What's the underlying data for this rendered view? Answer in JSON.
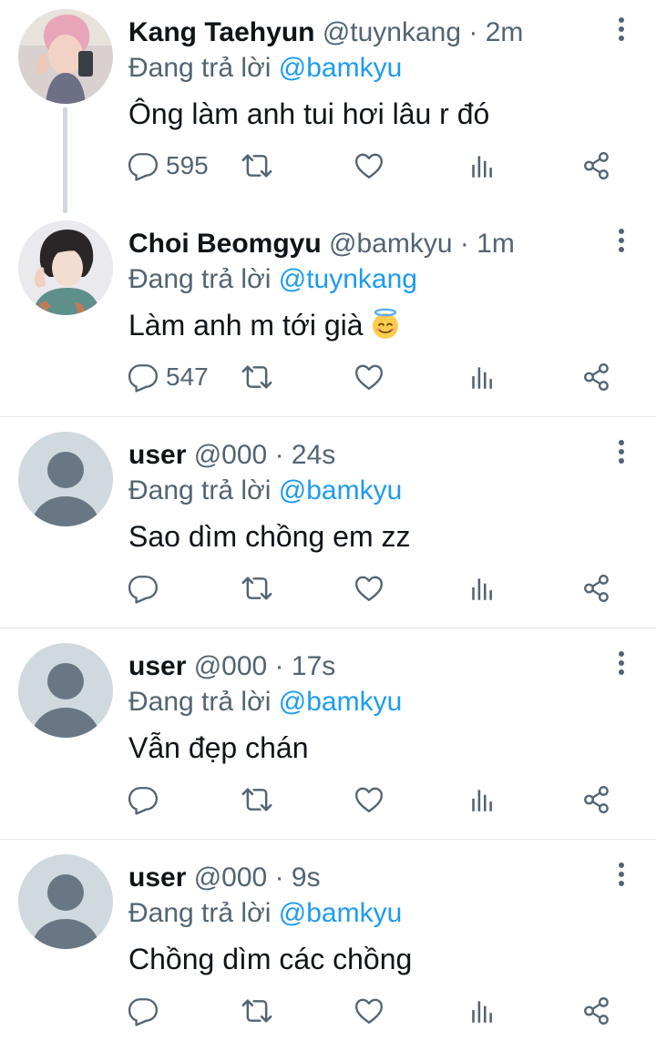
{
  "colors": {
    "accent": "#1d9bf0",
    "muted": "#536471",
    "text": "#0f1419"
  },
  "tweets": [
    {
      "name": "Kang Taehyun",
      "handle": "@tuynkang",
      "time": "· 2m",
      "reply_prefix": "Đang trả lời",
      "reply_to": "@bamkyu",
      "text": "Ông làm anh tui hơi lâu r đó",
      "reply_count": "595",
      "avatar": "photo-avatar"
    },
    {
      "name": "Choi Beomgyu",
      "handle": "@bamkyu",
      "time": "· 1m",
      "reply_prefix": "Đang trả lời",
      "reply_to": "@tuynkang",
      "text": "Làm anh m tới già",
      "emoji": "smiling-face-with-halo-icon",
      "reply_count": "547",
      "avatar": "photo-avatar"
    },
    {
      "name": "user",
      "handle": "@000",
      "time": "· 24s",
      "reply_prefix": "Đang trả lời",
      "reply_to": "@bamkyu",
      "text": "Sao dìm chồng em zz",
      "reply_count": "",
      "avatar": "default-avatar"
    },
    {
      "name": "user",
      "handle": "@000",
      "time": "· 17s",
      "reply_prefix": "Đang trả lời",
      "reply_to": "@bamkyu",
      "text": "Vẫn đẹp chán",
      "reply_count": "",
      "avatar": "default-avatar"
    },
    {
      "name": "user",
      "handle": "@000",
      "time": "· 9s",
      "reply_prefix": "Đang trả lời",
      "reply_to": "@bamkyu",
      "text": "Chồng dìm các chồng",
      "reply_count": "",
      "avatar": "default-avatar"
    }
  ],
  "action_icons": [
    "reply-icon",
    "retweet-icon",
    "like-icon",
    "analytics-icon",
    "share-icon"
  ]
}
